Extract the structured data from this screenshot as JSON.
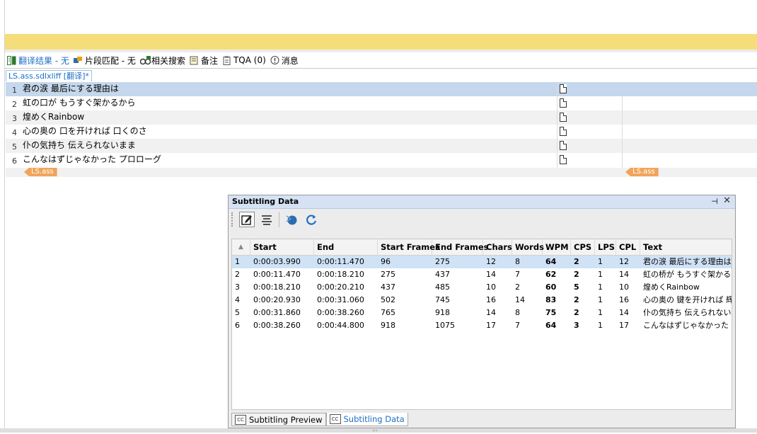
{
  "tabs": [
    {
      "label": "翻译结果 - 无",
      "icon": "translation-results-icon",
      "active": true
    },
    {
      "label": "片段匹配 - 无",
      "icon": "fragment-match-icon",
      "active": false
    },
    {
      "label": "相关搜索",
      "icon": "concordance-search-icon",
      "active": false
    },
    {
      "label": "备注",
      "icon": "comments-icon",
      "active": false
    },
    {
      "label": "TQA (0)",
      "icon": "tqa-icon",
      "active": false
    },
    {
      "label": "消息",
      "icon": "messages-icon",
      "active": false
    }
  ],
  "file_tab": "LS.ass.sdlxliff [翻译]*",
  "segments": [
    {
      "num": "1",
      "text": "君の涙 最后にする理由は"
    },
    {
      "num": "2",
      "text": "虹の口が もうすぐ架かるから"
    },
    {
      "num": "3",
      "text": "煌めくRainbow"
    },
    {
      "num": "4",
      "text": "心の奥の 口を开ければ 口くのさ"
    },
    {
      "num": "5",
      "text": "仆の気持ち 伝えられないまま"
    },
    {
      "num": "6",
      "text": "こんなはずじゃなかった プロローグ"
    }
  ],
  "end_tag_left": "LS.ass",
  "end_tag_right": "LS.ass",
  "panel": {
    "title": "Subtitling Data",
    "pin_symbol": "⊣",
    "close_symbol": "✕",
    "sort_glyph": "▲",
    "columns": [
      "Start",
      "End",
      "Start Frames",
      "End Frames",
      "Chars",
      "Words",
      "WPM",
      "CPS",
      "LPS",
      "CPL",
      "Text"
    ],
    "rows": [
      [
        "1",
        "0:00:03.990",
        "0:00:11.470",
        "96",
        "275",
        "12",
        "8",
        "64",
        "2",
        "1",
        "12",
        "君の涙 最后にする理由は"
      ],
      [
        "2",
        "0:00:11.470",
        "0:00:18.210",
        "275",
        "437",
        "14",
        "7",
        "62",
        "2",
        "1",
        "14",
        "虹の桥が もうすぐ架かるから"
      ],
      [
        "3",
        "0:00:18.210",
        "0:00:20.210",
        "437",
        "485",
        "10",
        "2",
        "60",
        "5",
        "1",
        "10",
        "煌めくRainbow"
      ],
      [
        "4",
        "0:00:20.930",
        "0:00:31.060",
        "502",
        "745",
        "16",
        "14",
        "83",
        "2",
        "1",
        "16",
        "心の奥の 键を开ければ 辉くのさ"
      ],
      [
        "5",
        "0:00:31.860",
        "0:00:38.260",
        "765",
        "918",
        "14",
        "8",
        "75",
        "2",
        "1",
        "14",
        "仆の気持ち 伝えられないまま"
      ],
      [
        "6",
        "0:00:38.260",
        "0:00:44.800",
        "918",
        "1075",
        "17",
        "7",
        "64",
        "3",
        "1",
        "17",
        "こんなはずじゃなかった プロローグ"
      ]
    ],
    "bottom_tabs": [
      {
        "label": "Subtitling Preview",
        "active": false
      },
      {
        "label": "Subtitling Data",
        "active": true
      }
    ]
  },
  "colors": {
    "accent": "#1f6fc4",
    "highlight": "#f5dd79",
    "selected_row": "#c5d7ec",
    "tag": "#f0a45a"
  }
}
